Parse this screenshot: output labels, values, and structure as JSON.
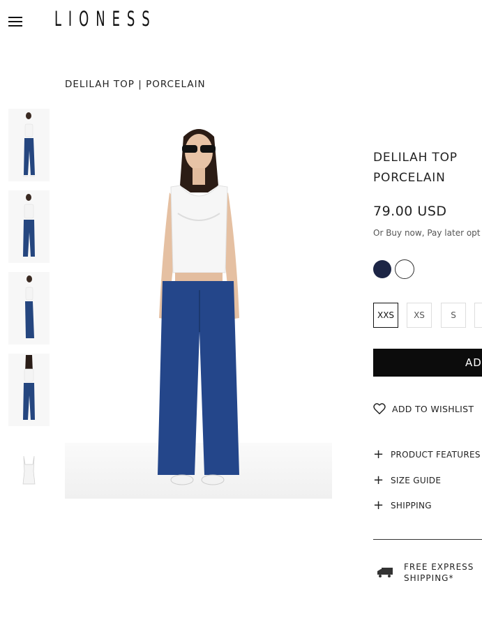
{
  "header": {
    "menu_icon": "hamburger-icon",
    "logo": "LIONESS"
  },
  "breadcrumb": "DELILAH TOP | PORCELAIN",
  "gallery": {
    "thumbnails": [
      "front-view",
      "front-view-close",
      "side-view",
      "back-view",
      "product-flat"
    ],
    "main_image": "model-front-view"
  },
  "product": {
    "title_line1": "DELILAH TOP",
    "title_line2": "PORCELAIN",
    "price": "79.00 USD",
    "bnpl": "Or Buy now, Pay later opt",
    "colors": [
      {
        "name": "navy",
        "hex": "#1c2545"
      },
      {
        "name": "white",
        "hex": "#ffffff",
        "selected": true
      }
    ],
    "sizes": [
      {
        "label": "XXS",
        "selected": true
      },
      {
        "label": "XS"
      },
      {
        "label": "S"
      }
    ],
    "add_label": "AD",
    "wishlist_label": "ADD TO WISHLIST",
    "wishlist_icon": "heart-icon",
    "accordions": [
      {
        "label": "PRODUCT FEATURES"
      },
      {
        "label": "SIZE GUIDE"
      },
      {
        "label": "SHIPPING"
      }
    ],
    "shipping_icon": "truck-icon",
    "shipping_line1": "FREE EXPRESS",
    "shipping_line2": "SHIPPING*"
  }
}
